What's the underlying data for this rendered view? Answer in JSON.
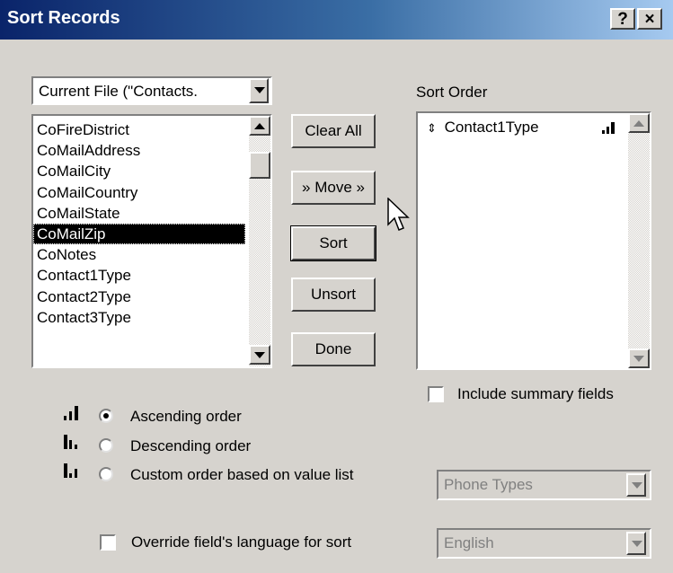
{
  "window": {
    "title": "Sort Records",
    "help_label": "?",
    "close_label": "×"
  },
  "file_combo": {
    "value": "Current File (\"Contacts."
  },
  "field_list": {
    "items": [
      "CoFireDistrict",
      "CoMailAddress",
      "CoMailCity",
      "CoMailCountry",
      "CoMailState",
      "CoMailZip",
      "CoNotes",
      "Contact1Type",
      "Contact2Type",
      "Contact3Type"
    ],
    "selected": "CoMailZip"
  },
  "buttons": {
    "clear_all": "Clear All",
    "move": "» Move »",
    "sort": "Sort",
    "unsort": "Unsort",
    "done": "Done"
  },
  "sort_order": {
    "label": "Sort Order",
    "items": [
      {
        "marker": "⇕",
        "name": "Contact1Type",
        "order_icon": "ascending-order-icon"
      }
    ]
  },
  "include_summary": {
    "label": "Include summary fields",
    "checked": false
  },
  "order_options": {
    "ascending": {
      "label": "Ascending order",
      "selected": true
    },
    "descending": {
      "label": "Descending order",
      "selected": false
    },
    "custom": {
      "label": "Custom order based on value list",
      "selected": false
    }
  },
  "value_list_combo": {
    "value": "Phone Types",
    "enabled": false
  },
  "override_language": {
    "label": "Override field's language for sort",
    "checked": false
  },
  "language_combo": {
    "value": "English",
    "enabled": false
  },
  "colors": {
    "title_gradient_start": "#0a246a",
    "title_gradient_end": "#a6caf0",
    "dialog_bg": "#d6d3ce",
    "selection": "#000000"
  }
}
